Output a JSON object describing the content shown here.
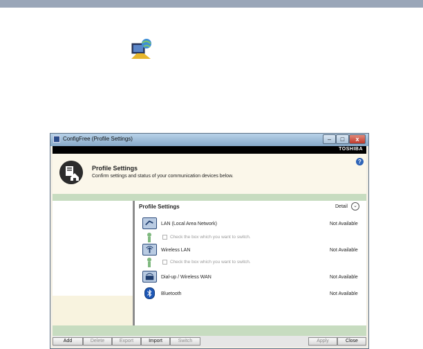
{
  "window": {
    "title": "ConfigFree (Profile Settings)",
    "controls": {
      "minimize": "–",
      "maximize": "□",
      "close": "x"
    },
    "brand": "TOSHIBA"
  },
  "header": {
    "title": "Profile Settings",
    "subtitle": "Confirm settings and status of your communication devices below.",
    "help": "?"
  },
  "main": {
    "title": "Profile Settings",
    "detail_label": "Detail",
    "detail_symbol": "⌄",
    "devices": [
      {
        "name": "LAN (Local Area Network)",
        "status": "Not Available",
        "icon": "lan-icon"
      },
      {
        "name": "Wireless LAN",
        "status": "Not Available",
        "icon": "wireless-lan-icon"
      },
      {
        "name": "Dial-up / Wireless WAN",
        "status": "Not Available",
        "icon": "dialup-icon"
      },
      {
        "name": "Bluetooth",
        "status": "Not Available",
        "icon": "bluetooth-icon"
      }
    ],
    "switch_hints": [
      "Check the box which you want to switch.",
      "Check the box which you want to switch."
    ]
  },
  "footer": {
    "buttons": [
      "Add",
      "Delete",
      "Export",
      "Import",
      "Switch"
    ],
    "apply": "Apply",
    "close": "Close"
  },
  "colors": {
    "green_band": "#c7dcc0",
    "header_bg": "#fbf7ea",
    "brand_bar": "#000000"
  }
}
